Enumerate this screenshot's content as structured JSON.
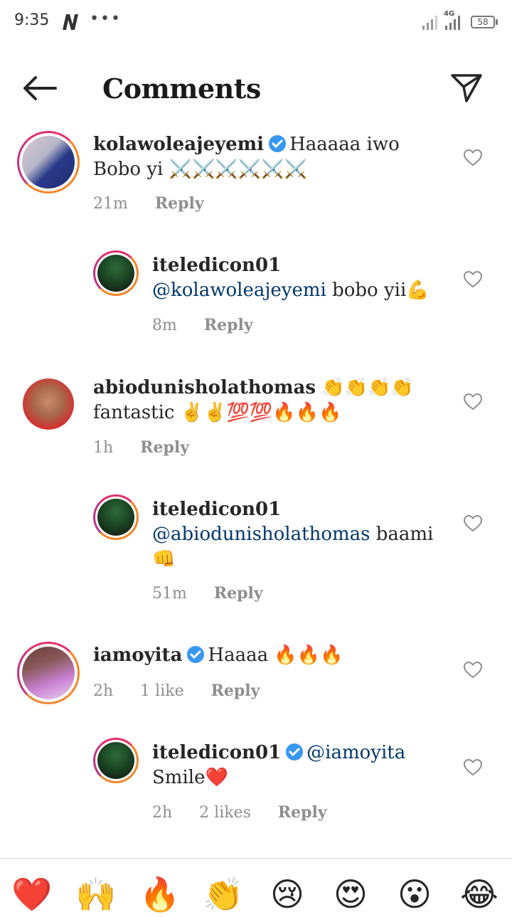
{
  "status_bar": {
    "time": "9:35",
    "network_type": "4G",
    "battery": "58",
    "dots": "•••"
  },
  "header": {
    "title": "Comments",
    "back_icon": "arrow-left-icon",
    "send_icon": "paper-plane-icon"
  },
  "comments": [
    {
      "username": "kolawoleajeyemi",
      "verified": true,
      "text_line1": "Haaaaa iwo",
      "text_line2": "Bobo yi ⚔️⚔️⚔️⚔️⚔️⚔️",
      "time": "21m",
      "reply_label": "Reply"
    },
    {
      "username": "iteledicon01",
      "mention": "@kolawoleajeyemi",
      "text": " bobo yii💪",
      "time": "8m",
      "reply_label": "Reply"
    },
    {
      "username": "abiodunisholathomas",
      "emojis": "👏👏👏👏",
      "text_line2": "fantastic ✌✌💯💯🔥🔥🔥",
      "time": "1h",
      "reply_label": "Reply"
    },
    {
      "username": "iteledicon01",
      "mention": "@abiodunisholathomas",
      "text": " baami",
      "text_line3": "👊",
      "time": "51m",
      "reply_label": "Reply"
    },
    {
      "username": "iamoyita",
      "verified": true,
      "text": "Haaaa 🔥🔥🔥",
      "time": "2h",
      "likes": "1 like",
      "reply_label": "Reply"
    },
    {
      "username": "iteledicon01",
      "verified": true,
      "mention": "@iamoyita",
      "text_line2": "Smile❤️",
      "time": "2h",
      "likes": "2 likes",
      "reply_label": "Reply"
    }
  ],
  "reactions": [
    "❤️",
    "🙌",
    "🔥",
    "👏",
    "😢",
    "😍",
    "😮",
    "😂"
  ],
  "colors": {
    "verified_blue": "#3897f0",
    "mention": "#00376b",
    "meta_gray": "#8e8e8e"
  }
}
